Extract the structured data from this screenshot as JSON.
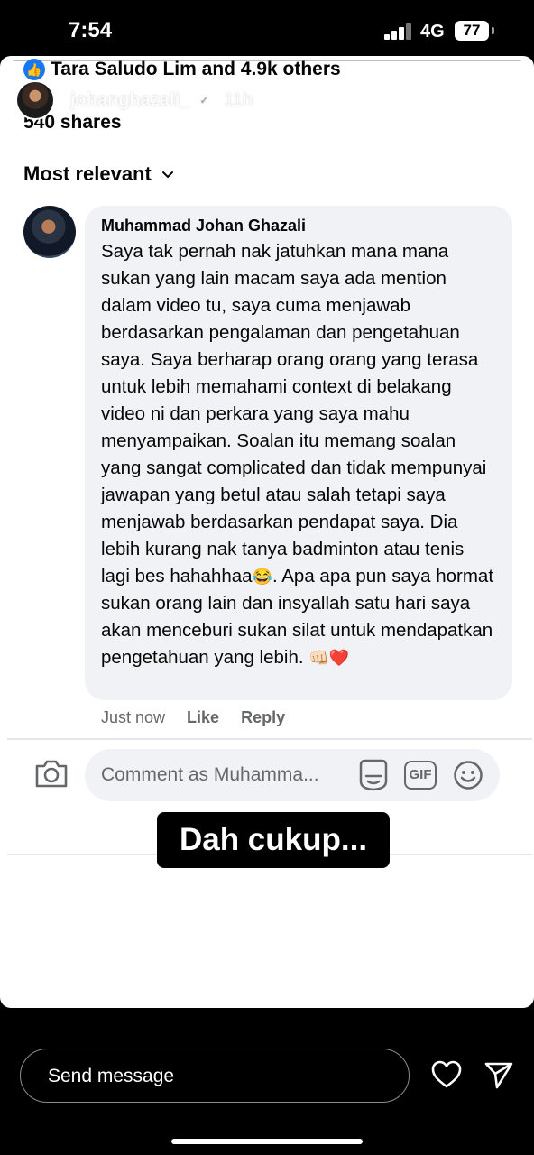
{
  "status": {
    "time": "7:54",
    "network": "4G",
    "battery": "77"
  },
  "story": {
    "username": "johanghazali_",
    "age": "11h",
    "caption": "Dah cukup...",
    "send_placeholder": "Send message"
  },
  "post": {
    "reactions": "Tara Saludo Lim and 4.9k others",
    "shares": "540 shares",
    "sort_label": "Most relevant"
  },
  "comment": {
    "author": "Muhammad Johan Ghazali",
    "text": "Saya tak pernah nak jatuhkan mana mana sukan yang lain macam saya ada mention dalam video tu, saya cuma menjawab berdasarkan pengalaman dan pengetahuan saya. Saya berharap orang orang yang terasa untuk lebih memahami context di belakang video ni dan perkara yang saya mahu menyampaikan. Soalan itu memang soalan yang sangat complicated dan tidak mempunyai jawapan yang betul atau salah tetapi saya menjawab berdasarkan pendapat saya. Dia lebih kurang nak tanya badminton atau tenis lagi bes hahahhaa",
    "text_emoji": "😂",
    "text2": ". Apa apa pun saya hormat sukan orang lain dan insyallah satu hari saya akan menceburi sukan silat untuk mendapatkan pengetahuan yang lebih. ",
    "end_emoji": "👊🏻❤️",
    "time": "Just now",
    "like_label": "Like",
    "reply_label": "Reply"
  },
  "composer": {
    "placeholder": "Comment as Muhamma...",
    "gif_label": "GIF"
  },
  "colors": {
    "facebook_blue": "#1877f2",
    "bubble": "#f0f2f5",
    "secondary_text": "#65676b"
  }
}
